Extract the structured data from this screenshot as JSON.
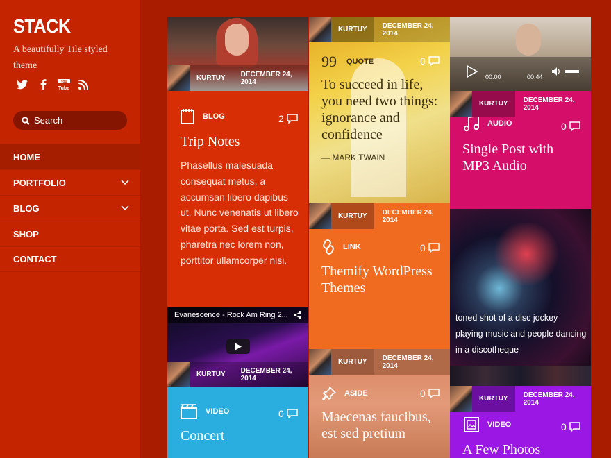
{
  "site": {
    "title": "STACK",
    "description": "A beautifully Tile styled theme"
  },
  "social": [
    "twitter-icon",
    "facebook-icon",
    "youtube-icon",
    "rss-icon"
  ],
  "search": {
    "placeholder": "Search"
  },
  "nav": [
    {
      "label": "HOME",
      "active": true,
      "has_children": false
    },
    {
      "label": "PORTFOLIO",
      "active": false,
      "has_children": true
    },
    {
      "label": "BLOG",
      "active": false,
      "has_children": true
    },
    {
      "label": "SHOP",
      "active": false,
      "has_children": false
    },
    {
      "label": "CONTACT",
      "active": false,
      "has_children": false
    }
  ],
  "posts": {
    "trip": {
      "author": "KURTUY",
      "date": "DECEMBER 24, 2014",
      "category": "BLOG",
      "comments": "2",
      "title": "Trip Notes",
      "excerpt": "Phasellus malesuada consequat metus, a accumsan libero dapibus ut. Nunc venenatis ut libero vitae porta. Sed est turpis, pharetra nec lorem non, porttitor ullamcorper nisi."
    },
    "quote": {
      "author": "KURTUY",
      "date": "DECEMBER 24, 2014",
      "number": "99",
      "category": "QUOTE",
      "comments": "0",
      "text": "To succeed in life, you need two things: ignorance and confidence",
      "attribution": "— MARK TWAIN"
    },
    "audio": {
      "author": "KURTUY",
      "date": "DECEMBER 24, 2014",
      "category": "AUDIO",
      "comments": "0",
      "title": "Single Post with MP3 Audio",
      "player": {
        "current": "00:00",
        "duration": "00:44"
      }
    },
    "link": {
      "author": "KURTUY",
      "date": "DECEMBER 24, 2014",
      "category": "LINK",
      "comments": "0",
      "title": "Themify WordPress Themes"
    },
    "photo": {
      "caption": "toned shot of a disc jockey playing music and people dancing in a discotheque"
    },
    "video": {
      "embed_title": "Evanescence - Rock Am Ring 2...",
      "author": "KURTUY",
      "date": "DECEMBER 24, 2014",
      "category": "VIDEO",
      "comments": "0",
      "title": "Concert"
    },
    "aside": {
      "author": "KURTUY",
      "date": "DECEMBER 24, 2014",
      "category": "ASIDE",
      "comments": "0",
      "title": "Maecenas faucibus, est sed pretium"
    },
    "gallery": {
      "author": "KURTUY",
      "date": "DECEMBER 24, 2014",
      "category": "VIDEO",
      "comments": "0",
      "title": "A Few Photos"
    }
  },
  "colors": {
    "sidebar": "#c42400",
    "background": "#a91c00",
    "blog": "#d82e05",
    "quote": "#f0c020",
    "audio": "#d50e6a",
    "link": "#f06a1f",
    "video": "#2aaee0",
    "aside": "#e18358",
    "gallery": "#9b17e3"
  }
}
